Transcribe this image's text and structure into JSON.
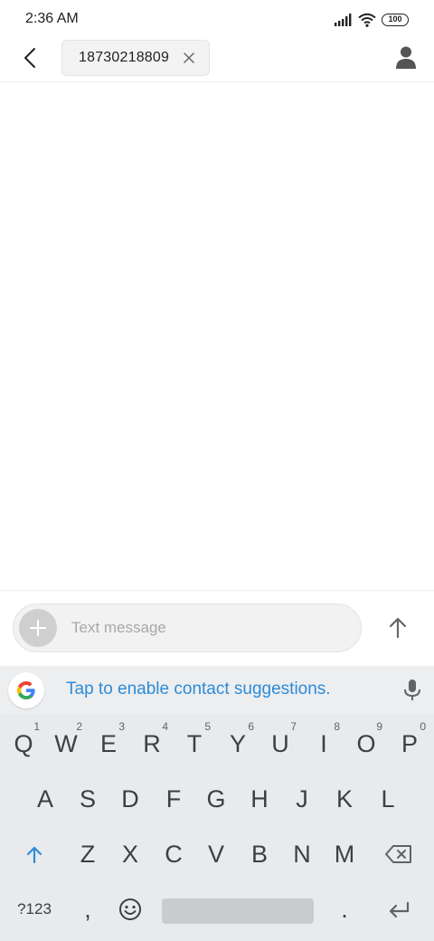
{
  "status_bar": {
    "time": "2:36 AM",
    "battery": "100"
  },
  "app_bar": {
    "recipient": "18730218809"
  },
  "compose": {
    "placeholder": "Text message"
  },
  "keyboard": {
    "suggestion": "Tap to enable contact suggestions.",
    "row1": [
      {
        "key": "Q",
        "hint": "1"
      },
      {
        "key": "W",
        "hint": "2"
      },
      {
        "key": "E",
        "hint": "3"
      },
      {
        "key": "R",
        "hint": "4"
      },
      {
        "key": "T",
        "hint": "5"
      },
      {
        "key": "Y",
        "hint": "6"
      },
      {
        "key": "U",
        "hint": "7"
      },
      {
        "key": "I",
        "hint": "8"
      },
      {
        "key": "O",
        "hint": "9"
      },
      {
        "key": "P",
        "hint": "0"
      }
    ],
    "row2": [
      "A",
      "S",
      "D",
      "F",
      "G",
      "H",
      "J",
      "K",
      "L"
    ],
    "row3": [
      "Z",
      "X",
      "C",
      "V",
      "B",
      "N",
      "M"
    ],
    "row4": {
      "symbols": "?123",
      "comma": ",",
      "period": "."
    },
    "icons": {
      "shift": "shift-icon",
      "backspace": "backspace-icon",
      "emoji": "emoji-icon",
      "enter": "enter-icon",
      "mic": "mic-icon",
      "google": "google-icon"
    },
    "accent_color": "#2e8bd8"
  }
}
